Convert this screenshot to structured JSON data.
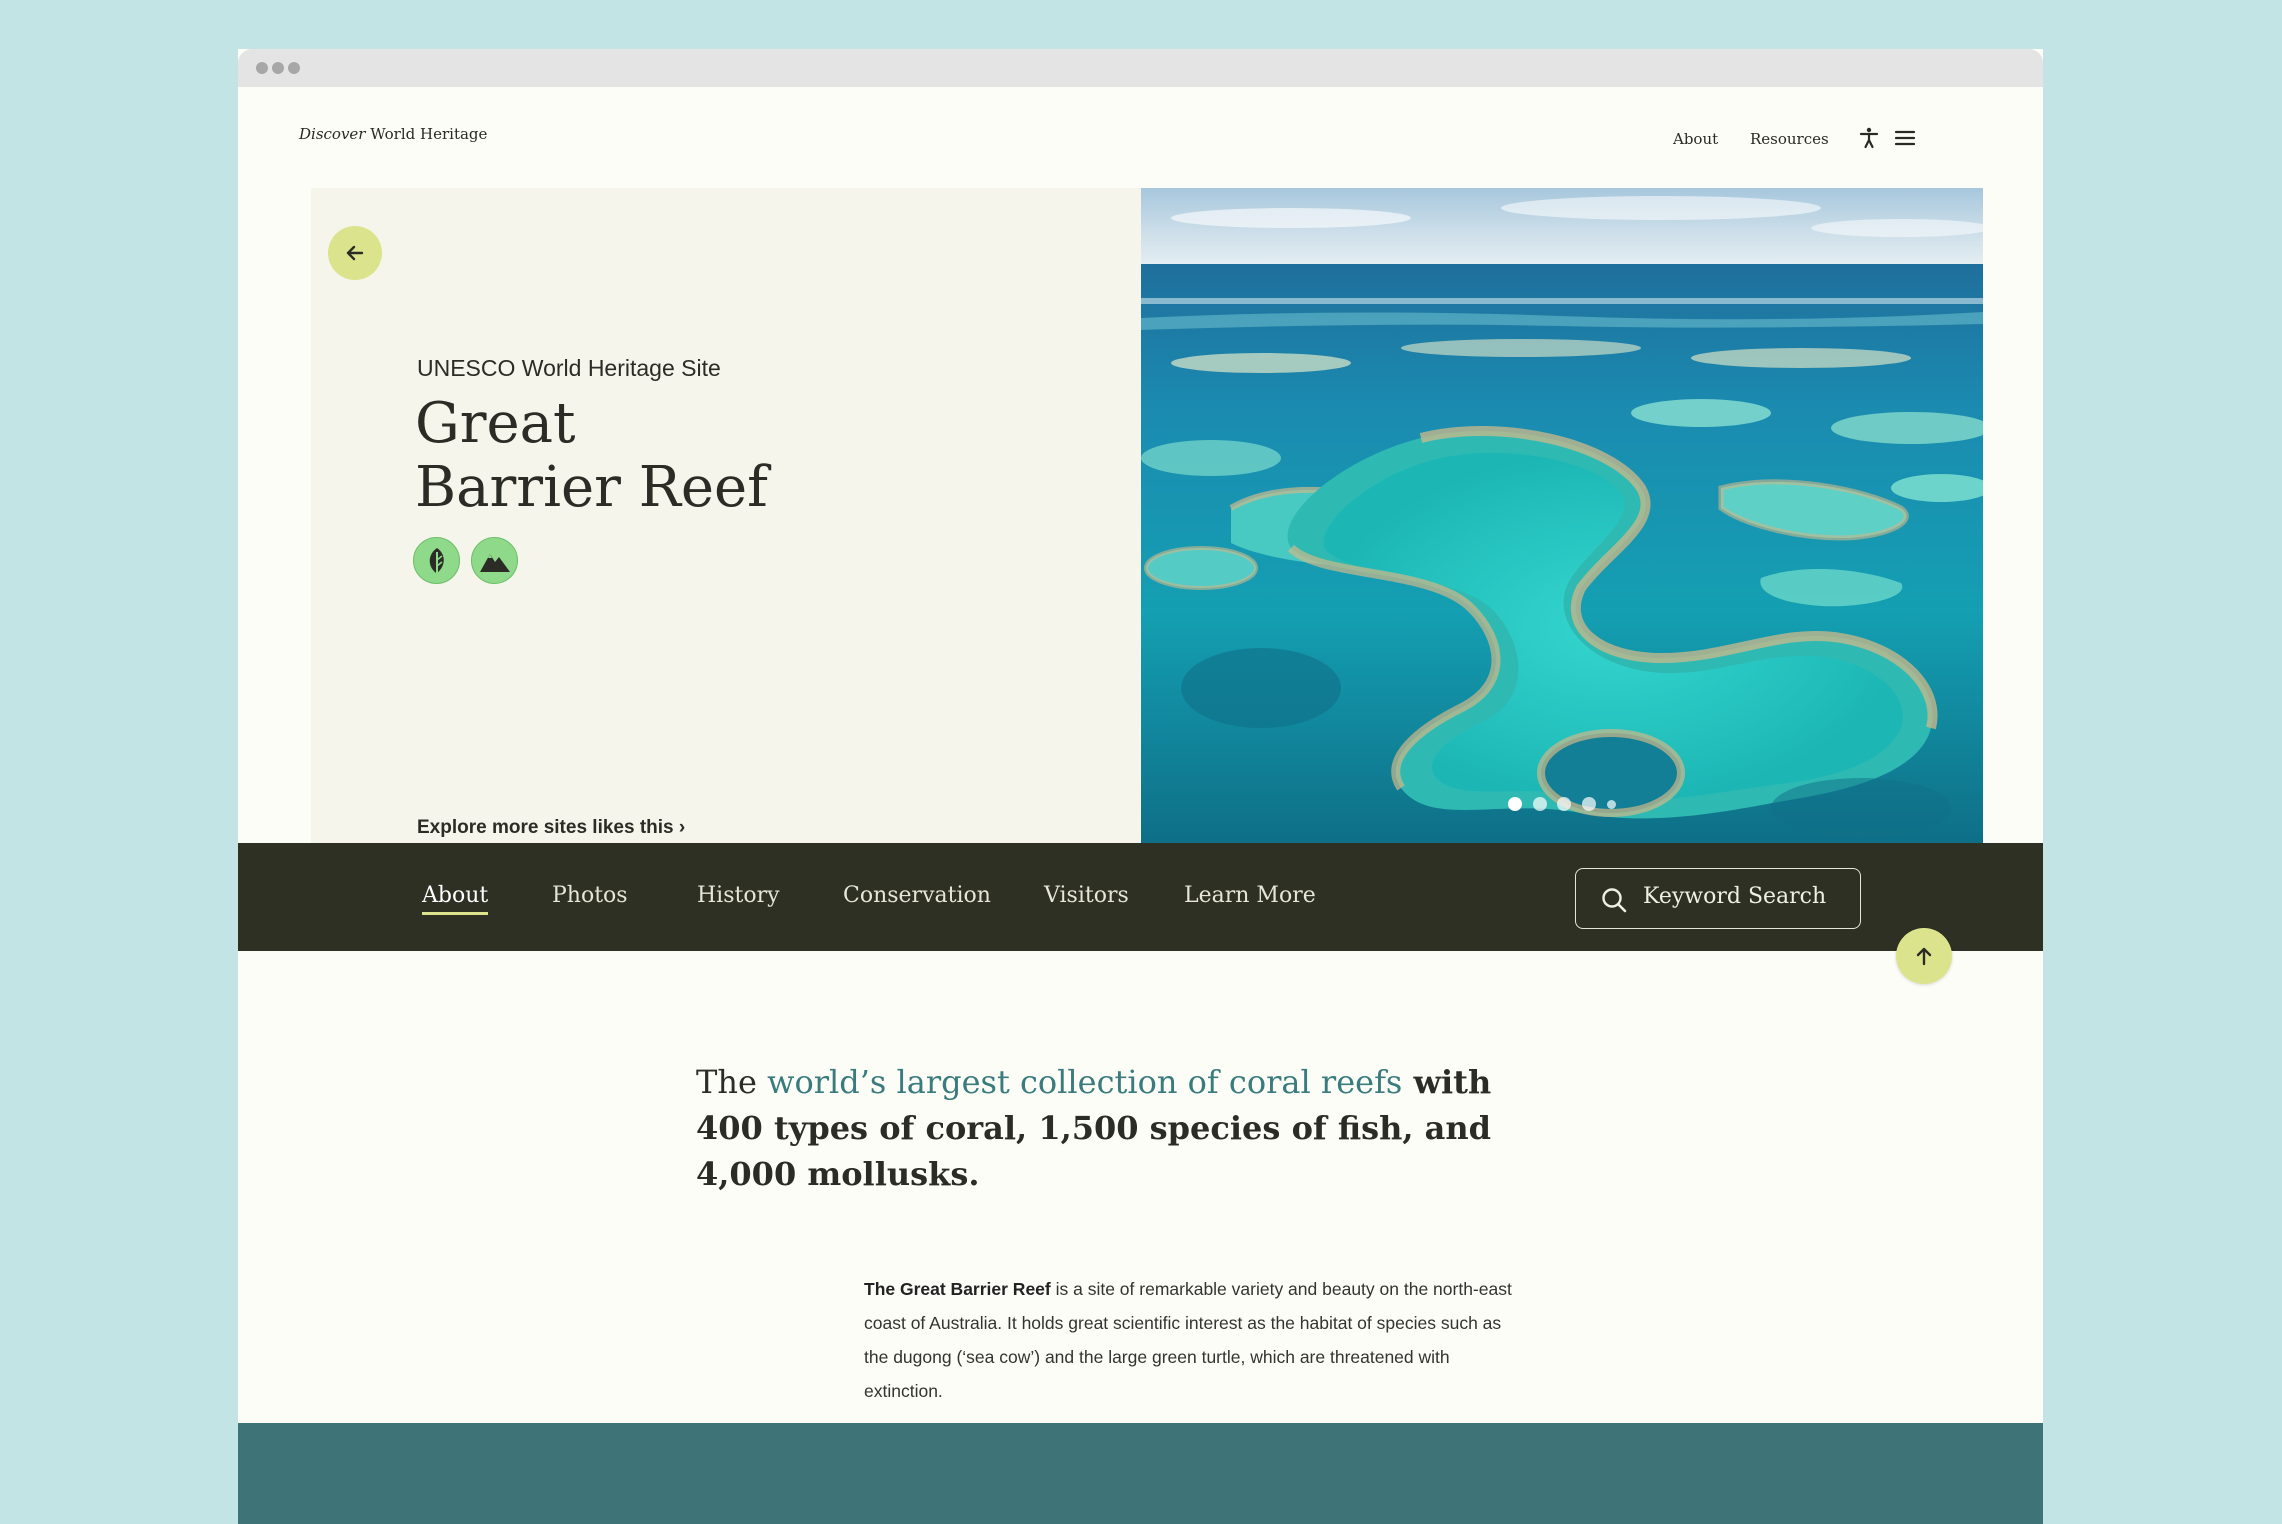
{
  "brand": {
    "italic": "Discover",
    "rest": " World Heritage"
  },
  "top_nav": {
    "about": "About",
    "resources": "Resources"
  },
  "icons": {
    "accessibility": "accessibility-icon",
    "menu": "hamburger-menu-icon",
    "back": "arrow-left-icon",
    "to_top": "arrow-up-icon",
    "search": "search-icon",
    "leaf": "leaf-icon",
    "mountain": "mountain-icon"
  },
  "hero": {
    "eyebrow": "UNESCO World Heritage Site",
    "title_line1": "Great",
    "title_line2": "Barrier Reef",
    "explore_link": "Explore more sites likes this ›",
    "carousel": {
      "slides": 5,
      "active": 1
    }
  },
  "section_nav": {
    "items": [
      "About",
      "Photos",
      "History",
      "Conservation",
      "Visitors",
      "Learn More"
    ],
    "active": "About",
    "search_placeholder": "Keyword Search"
  },
  "intro": {
    "headline_pre": "The ",
    "headline_accent": "world’s largest collection of coral reefs",
    "headline_rest": " with 400 types of coral, 1,500 species of fish, and 4,000 mollusks.",
    "body_bold": "The Great Barrier Reef",
    "body_rest": " is a site of remarkable variety and beauty on the north-east coast of Australia. It holds great scientific interest as the habitat of species such as the dugong (‘sea cow’) and the large green turtle, which are threatened with extinction."
  },
  "colors": {
    "accent_teal": "#3a7b7d",
    "nav_dark": "#2e3024",
    "button_lime": "#dbe48c",
    "tag_green": "#8fd98b",
    "footer_band": "#3e7478"
  }
}
